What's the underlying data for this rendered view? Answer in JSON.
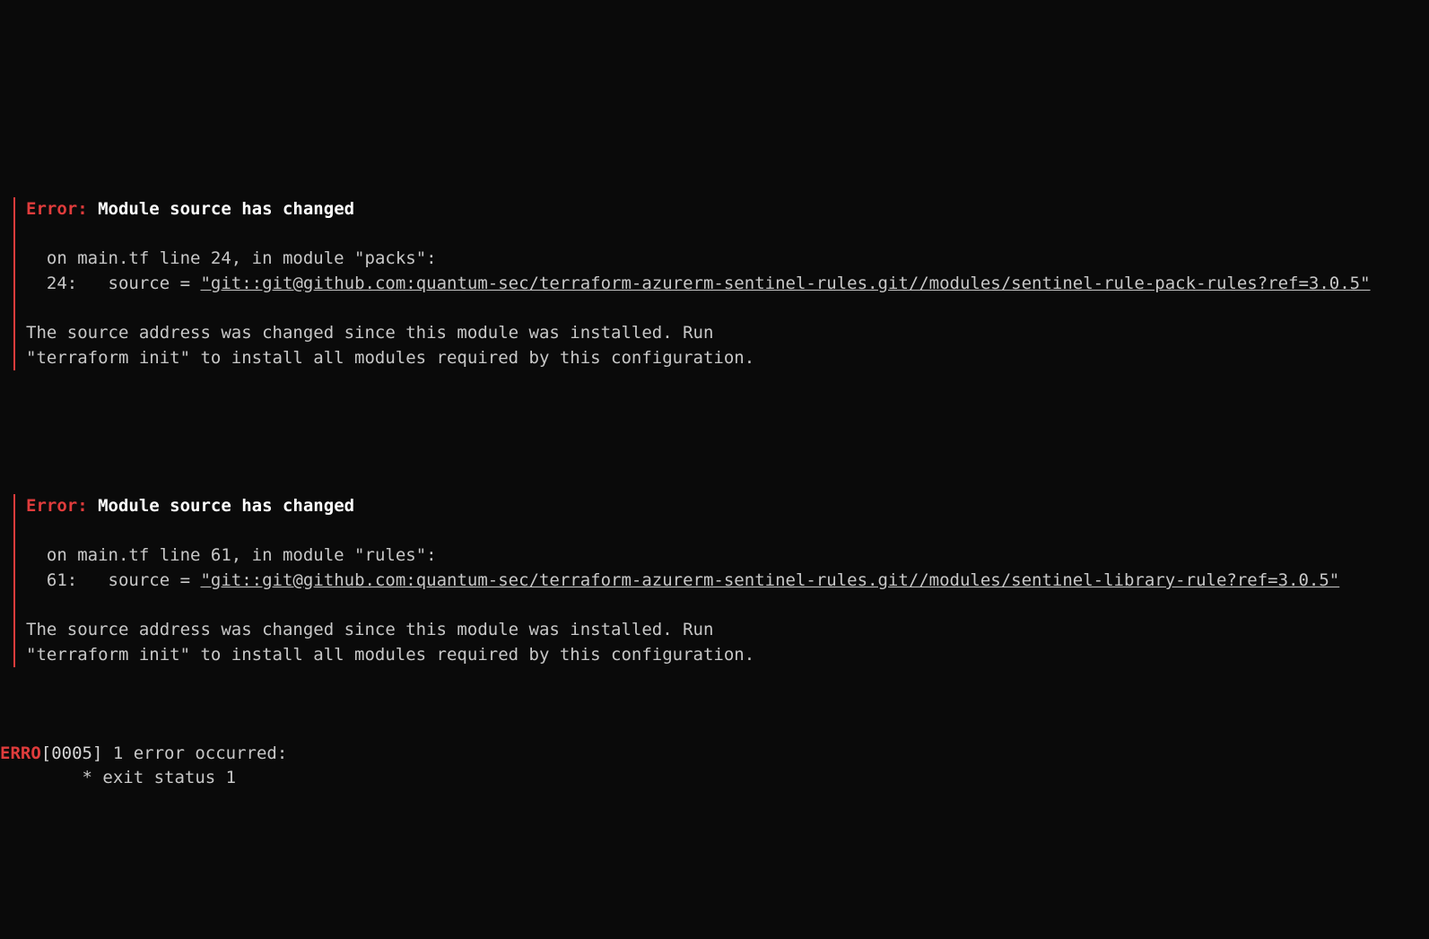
{
  "errors": [
    {
      "label": "Error:",
      "title": "Module source has changed",
      "location": "  on main.tf line 24, in module \"packs\":",
      "code_prefix": "  24:   source = ",
      "source_url": "\"git::git@github.com:quantum-sec/terraform-azurerm-sentinel-rules.git//modules/sentinel-rule-pack-rules?ref=3.0.5\"",
      "explain1": "The source address was changed since this module was installed. Run",
      "explain2": "\"terraform init\" to install all modules required by this configuration."
    },
    {
      "label": "Error:",
      "title": "Module source has changed",
      "location": "  on main.tf line 61, in module \"rules\":",
      "code_prefix": "  61:   source = ",
      "source_url": "\"git::git@github.com:quantum-sec/terraform-azurerm-sentinel-rules.git//modules/sentinel-library-rule?ref=3.0.5\"",
      "explain1": "The source address was changed since this module was installed. Run",
      "explain2": "\"terraform init\" to install all modules required by this configuration."
    }
  ],
  "footer": {
    "erro": "ERRO",
    "ts": "[0005] ",
    "msg": "1 error occurred:",
    "detail": "        * exit status 1"
  }
}
